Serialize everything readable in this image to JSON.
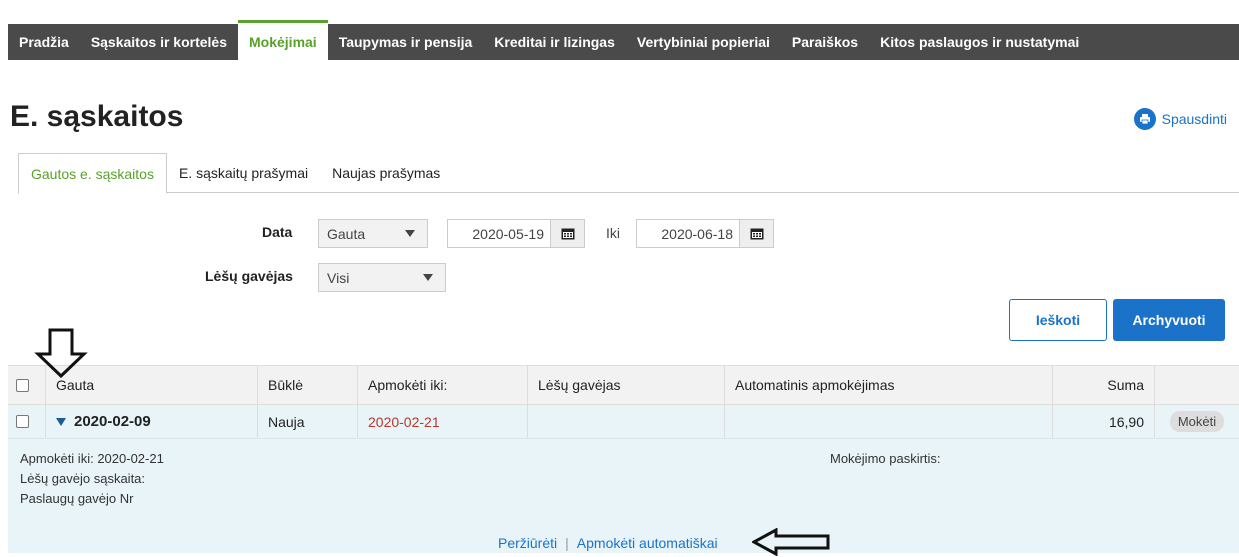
{
  "nav": [
    "Pradžia",
    "Sąskaitos ir kortelės",
    "Mokėjimai",
    "Taupymas ir pensija",
    "Kreditai ir lizingas",
    "Vertybiniai popieriai",
    "Paraiškos",
    "Kitos paslaugos ir nustatymai"
  ],
  "title": "E. sąskaitos",
  "print_label": "Spausdinti",
  "tabs": [
    "Gautos e. sąskaitos",
    "E. sąskaitų prašymai",
    "Naujas prašymas"
  ],
  "filters": {
    "date_label": "Data",
    "date_type": "Gauta",
    "from": "2020-05-19",
    "to_label": "Iki",
    "to": "2020-06-18",
    "payee_label": "Lėšų gavėjas",
    "payee_value": "Visi"
  },
  "buttons": {
    "search": "Ieškoti",
    "archive": "Archyvuoti"
  },
  "table": {
    "headers": [
      "Gauta",
      "Būklė",
      "Apmokėti iki:",
      "Lėšų gavėjas",
      "Automatinis apmokėjimas",
      "Suma"
    ],
    "row": {
      "date": "2020-02-09",
      "state": "Nauja",
      "due": "2020-02-21",
      "payee": "",
      "auto": "",
      "amount": "16,90",
      "action": "Mokėti"
    }
  },
  "details": {
    "due_label": "Apmokėti iki:",
    "due_value": "2020-02-21",
    "payee_account_label": "Lėšų gavėjo sąskaita:",
    "service_receiver_label": "Paslaugų gavėjo Nr",
    "purpose_label": "Mokėjimo paskirtis:",
    "view_link": "Peržiūrėti",
    "auto_link": "Apmokėti automatiškai"
  },
  "colors": {
    "nav_bg": "#4a4a4a",
    "accent_green": "#5aa02c",
    "primary_blue": "#1a73c9",
    "row_bg": "#e8f4f8",
    "due_red": "#b53a2e"
  }
}
